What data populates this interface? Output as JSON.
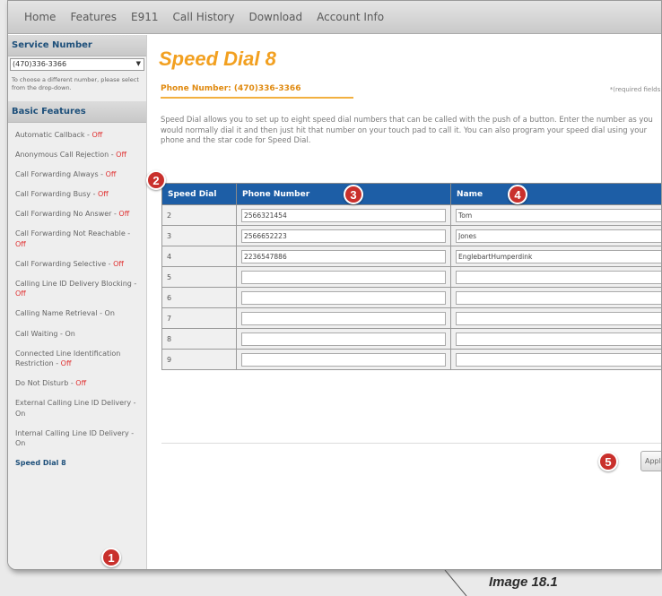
{
  "nav": [
    "Home",
    "Features",
    "E911",
    "Call History",
    "Download",
    "Account Info"
  ],
  "sidebar": {
    "service_header": "Service Number",
    "service_value": "(470)336-3366",
    "service_note": "To choose a different number, please select from the drop-down.",
    "basic_header": "Basic Features",
    "features": [
      {
        "label": "Automatic Callback - ",
        "state": "Off"
      },
      {
        "label": "Anonymous Call Rejection - ",
        "state": "Off"
      },
      {
        "label": "Call Forwarding Always - ",
        "state": "Off"
      },
      {
        "label": "Call Forwarding Busy - ",
        "state": "Off"
      },
      {
        "label": "Call Forwarding No Answer - ",
        "state": "Off"
      },
      {
        "label": "Call Forwarding Not Reachable - ",
        "state": "Off"
      },
      {
        "label": "Call Forwarding Selective - ",
        "state": "Off"
      },
      {
        "label": "Calling Line ID Delivery Blocking - ",
        "state": "Off"
      },
      {
        "label": "Calling Name Retrieval - ",
        "state": "On"
      },
      {
        "label": "Call Waiting - ",
        "state": "On"
      },
      {
        "label": "Connected Line Identification Restriction - ",
        "state": "Off"
      },
      {
        "label": "Do Not Disturb - ",
        "state": "Off"
      },
      {
        "label": "External Calling Line ID Delivery - ",
        "state": "On"
      },
      {
        "label": "Internal Calling Line ID Delivery - ",
        "state": "On"
      },
      {
        "label": "Speed Dial 8",
        "state": ""
      }
    ]
  },
  "main": {
    "title": "Speed Dial 8",
    "phone_line": "Phone Number: (470)336-3366",
    "required_note": "*(required fields)",
    "description": "Speed Dial allows you to set up to eight speed dial numbers that can be called with the push of a button. Enter the number as you would normally dial it and then just hit that number on your touch pad to call it. You can also program your speed dial using your phone and the star code for Speed Dial.",
    "table": {
      "headers": [
        "Speed Dial",
        "Phone Number",
        "Name"
      ],
      "rows": [
        {
          "dial": "2",
          "phone": "2566321454",
          "name": "Tom"
        },
        {
          "dial": "3",
          "phone": "2566652223",
          "name": "Jones"
        },
        {
          "dial": "4",
          "phone": "2236547886",
          "name": "EnglebartHumperdink"
        },
        {
          "dial": "5",
          "phone": "",
          "name": ""
        },
        {
          "dial": "6",
          "phone": "",
          "name": ""
        },
        {
          "dial": "7",
          "phone": "",
          "name": ""
        },
        {
          "dial": "8",
          "phone": "",
          "name": ""
        },
        {
          "dial": "9",
          "phone": "",
          "name": ""
        }
      ]
    },
    "apply_label": "Apply"
  },
  "badges": [
    "1",
    "2",
    "3",
    "4",
    "5"
  ],
  "caption": "Image 18.1",
  "colors": {
    "accent": "#f2a020",
    "header_blue": "#1d5ea6",
    "badge_red": "#c9302c",
    "off_red": "#e03030"
  }
}
